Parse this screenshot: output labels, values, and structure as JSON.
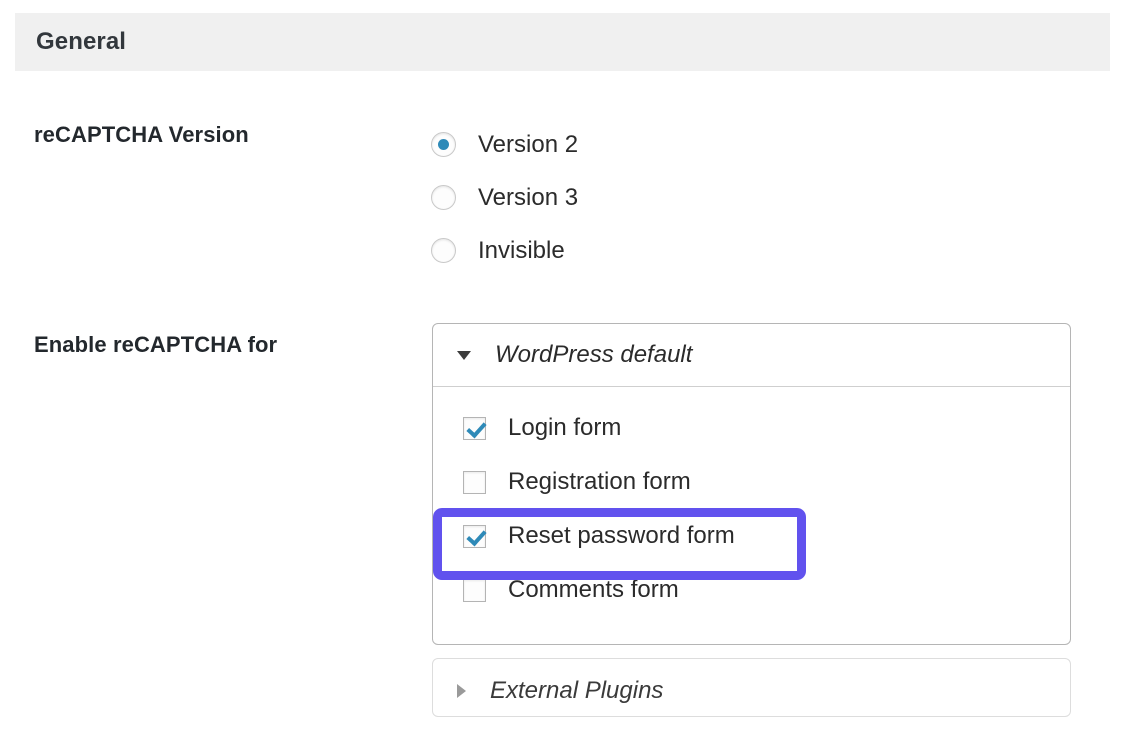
{
  "section": {
    "title": "General",
    "bg_color": "#f0f0f0"
  },
  "fields": {
    "version": {
      "label": "reCAPTCHA Version",
      "options": [
        {
          "label": "Version 2",
          "selected": true
        },
        {
          "label": "Version 3",
          "selected": false
        },
        {
          "label": "Invisible",
          "selected": false
        }
      ]
    },
    "enable_for": {
      "label": "Enable reCAPTCHA for",
      "panels": [
        {
          "title": "WordPress default",
          "expanded": true,
          "toggle_icon": "triangle-down-icon",
          "items": [
            {
              "label": "Login form",
              "checked": true
            },
            {
              "label": "Registration form",
              "checked": false
            },
            {
              "label": "Reset password form",
              "checked": true
            },
            {
              "label": "Comments form",
              "checked": false
            }
          ]
        },
        {
          "title": "External Plugins",
          "expanded": false,
          "toggle_icon": "triangle-right-icon",
          "items": []
        }
      ]
    }
  },
  "annotation": {
    "target_label": "Reset password form",
    "highlight_color": "#6152ee"
  },
  "colors": {
    "accent_blue": "#2e8ab8",
    "text_dark": "#23282d",
    "highlight_purple": "#6152ee",
    "panel_border": "#b5b5b5"
  }
}
